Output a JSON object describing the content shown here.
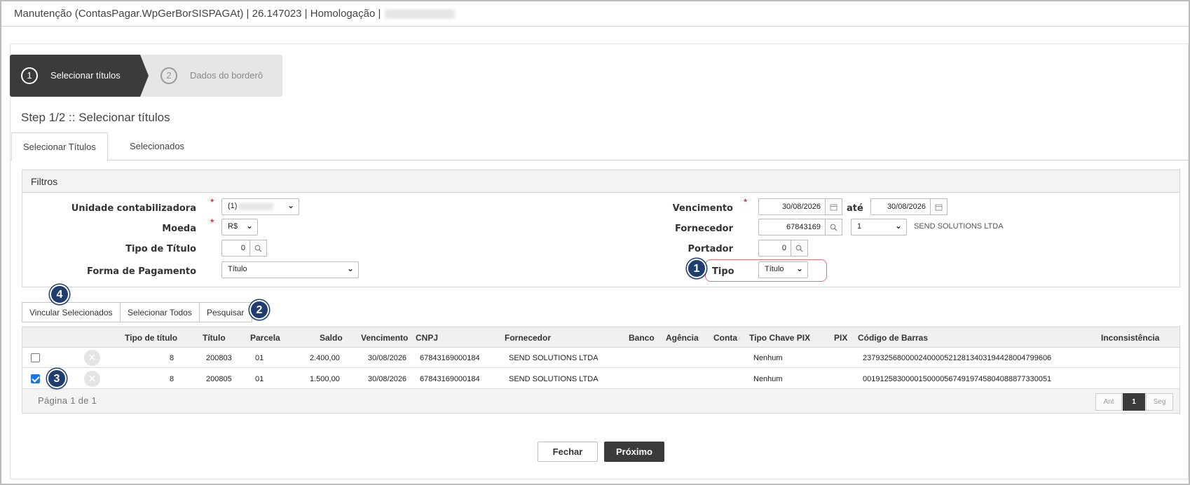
{
  "window": {
    "title": "Manutenção (ContasPagar.WpGerBorSISPAGAt) | 26.147023 | Homologação |"
  },
  "wizard": {
    "steps": [
      {
        "number": "1",
        "label": "Selecionar títulos"
      },
      {
        "number": "2",
        "label": "Dados do borderô"
      }
    ]
  },
  "page": {
    "heading": "Step 1/2 :: Selecionar títulos"
  },
  "tabs": [
    "Selecionar Títulos",
    "Selecionados"
  ],
  "filters": {
    "title": "Filtros",
    "unidade": {
      "label": "Unidade contabilizadora",
      "value": "(1)"
    },
    "moeda": {
      "label": "Moeda",
      "value": "R$"
    },
    "tipo_titulo": {
      "label": "Tipo de Título",
      "value": "0"
    },
    "forma_pagamento": {
      "label": "Forma de Pagamento",
      "value": "Título"
    },
    "vencimento": {
      "label": "Vencimento",
      "from": "30/08/2026",
      "ate_label": "até",
      "to": "30/08/2026"
    },
    "fornecedor": {
      "label": "Fornecedor",
      "value": "67843169",
      "loja": "1",
      "name": "SEND SOLUTIONS LTDA"
    },
    "portador": {
      "label": "Portador",
      "value": "0"
    },
    "tipo": {
      "label": "Tipo",
      "value": "Título"
    }
  },
  "toolbar": {
    "vincular": "Vincular Selecionados",
    "selecionar_todos": "Selecionar Todos",
    "pesquisar": "Pesquisar"
  },
  "annotations": {
    "b1": "1",
    "b2": "2",
    "b3": "3",
    "b4": "4"
  },
  "table": {
    "headers": {
      "tipo_titulo": "Tipo de título",
      "titulo": "Título",
      "parcela": "Parcela",
      "saldo": "Saldo",
      "vencimento": "Vencimento",
      "cnpj": "CNPJ",
      "fornecedor": "Fornecedor",
      "banco": "Banco",
      "agencia": "Agência",
      "conta": "Conta",
      "tipo_chave_pix": "Tipo Chave PIX",
      "pix": "PIX",
      "codigo_barras": "Código de Barras",
      "inconsistencia": "Inconsistência"
    },
    "rows": [
      {
        "checked": false,
        "tipo": "8",
        "titulo": "200803",
        "parcela": "01",
        "saldo": "2.400,00",
        "vencimento": "30/08/2026",
        "cnpj": "67843169000184",
        "fornecedor": "SEND SOLUTIONS LTDA",
        "tipo_chave_pix": "Nenhum",
        "codigo_barras": "23793256800002400005212813403194428004799606"
      },
      {
        "checked": true,
        "tipo": "8",
        "titulo": "200805",
        "parcela": "01",
        "saldo": "1.500,00",
        "vencimento": "30/08/2026",
        "cnpj": "67843169000184",
        "fornecedor": "SEND SOLUTIONS LTDA",
        "tipo_chave_pix": "Nenhum",
        "codigo_barras": "00191258300001500005674919745804088877330051"
      }
    ],
    "pagination": {
      "info": "Página 1 de 1",
      "prev": "Ant",
      "current": "1",
      "next": "Seg"
    }
  },
  "footer": {
    "fechar": "Fechar",
    "proximo": "Próximo"
  },
  "colors": {
    "dark": "#3b3b3b",
    "badge": "#1f3d6e",
    "highlight": "#e86f6f",
    "required": "#dd0000",
    "checkbox": "#1a73e8"
  }
}
